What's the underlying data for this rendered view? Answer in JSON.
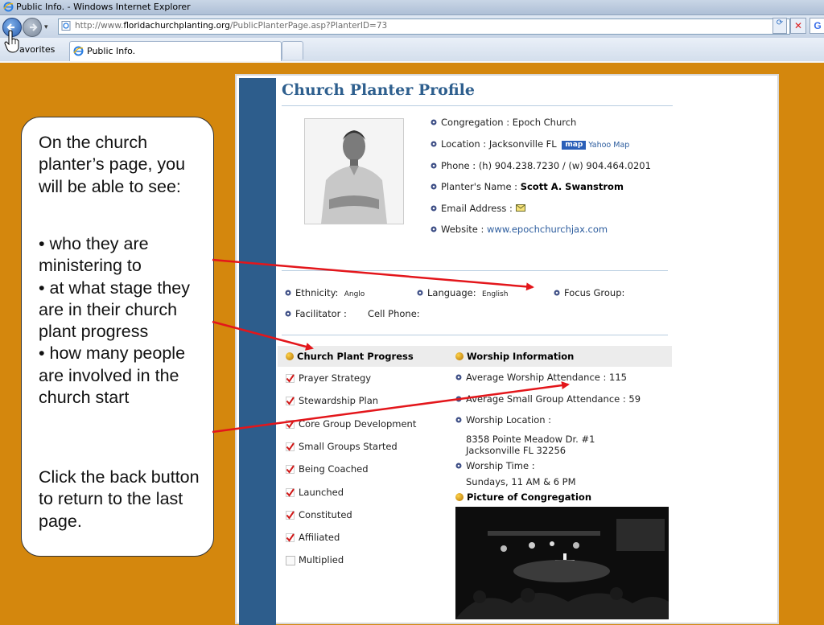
{
  "window": {
    "title": "Public Info. - Windows Internet Explorer"
  },
  "address_bar": {
    "url_prefix": "http://www.",
    "url_domain": "floridachurchplanting.org",
    "url_path": "/PublicPlanterPage.asp?PlanterID=73"
  },
  "tabs": {
    "favorites_label": "Favorites",
    "favorites_visible_text": "avorites",
    "active_tab_label": "Public Info."
  },
  "page": {
    "title": "Church Planter Profile",
    "congregation": {
      "label": "Congregation : ",
      "value": "Epoch Church"
    },
    "location": {
      "label": "Location : ",
      "value": "Jacksonville  FL",
      "map_badge": "map",
      "map_link": "Yahoo Map"
    },
    "phone": {
      "label": "Phone : ",
      "value": "(h) 904.238.7230 / (w) 904.464.0201"
    },
    "planter_name": {
      "label": "Planter's Name : ",
      "value": "Scott A. Swanstrom"
    },
    "email": {
      "label": "Email Address : "
    },
    "website": {
      "label": "Website : ",
      "value": "www.epochchurchjax.com"
    },
    "ethnicity": {
      "label": "Ethnicity:",
      "value": "Anglo"
    },
    "language": {
      "label": "Language:",
      "value": "English"
    },
    "focus_group": {
      "label": "Focus Group:"
    },
    "facilitator": {
      "label": "Facilitator :"
    },
    "cell_phone": {
      "label": "Cell Phone:"
    },
    "progress": {
      "heading": "Church Plant Progress",
      "items": [
        {
          "label": "Prayer Strategy",
          "checked": true
        },
        {
          "label": "Stewardship Plan",
          "checked": true
        },
        {
          "label": "Core Group Development",
          "checked": true
        },
        {
          "label": "Small Groups Started",
          "checked": true
        },
        {
          "label": "Being Coached",
          "checked": true
        },
        {
          "label": "Launched",
          "checked": true
        },
        {
          "label": "Constituted",
          "checked": true
        },
        {
          "label": "Affiliated",
          "checked": true
        },
        {
          "label": "Multiplied",
          "checked": false
        }
      ]
    },
    "worship": {
      "heading": "Worship Information",
      "avg_attendance": "Average Worship Attendance : 115",
      "avg_small_group": "Average Small Group Attendance : 59",
      "location_label": "Worship Location :",
      "address_line1": "8358 Pointe Meadow Dr. #1",
      "address_line2": "Jacksonville FL 32256",
      "time_label": "Worship Time :",
      "time_value": "Sundays, 11 AM & 6 PM",
      "picture_heading": "Picture of Congregation"
    }
  },
  "callout": {
    "intro": "On the church planter’s page, you will be able to see:",
    "bullets": [
      "•  who they are ministering to",
      "•  at what stage they are in their church plant progress",
      "•  how many people are involved in the church start"
    ],
    "outro": "Click the back button to return to the last page."
  },
  "colors": {
    "background_orange": "#d4870d",
    "sidebar_blue": "#2d5d8c",
    "title_blue": "#2e5f8e",
    "arrow_red": "#e3161b",
    "check_red": "#d11a1a"
  }
}
